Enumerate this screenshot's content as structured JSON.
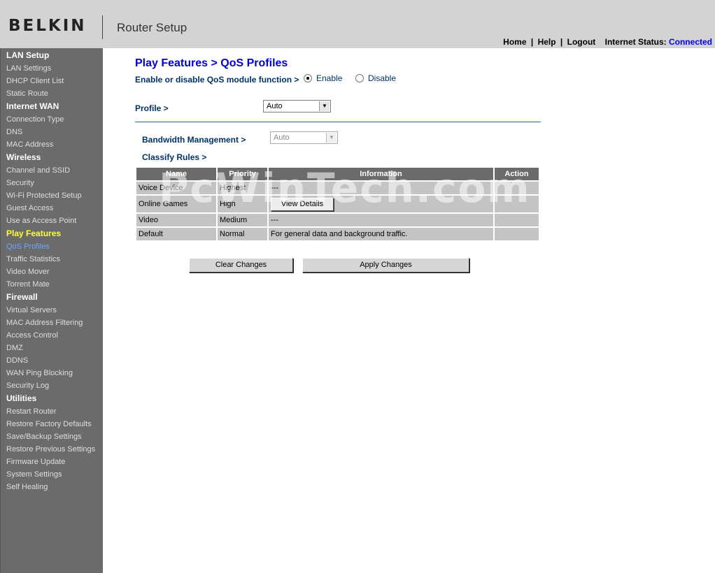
{
  "header": {
    "logo": "BELKIN",
    "title": "Router Setup",
    "nav": {
      "home": "Home",
      "help": "Help",
      "logout": "Logout",
      "separator": "|",
      "status_label": "Internet Status:",
      "status_value": "Connected"
    }
  },
  "sidebar": {
    "sections": [
      {
        "title": "LAN Setup",
        "items": [
          "LAN Settings",
          "DHCP Client List",
          "Static Route"
        ]
      },
      {
        "title": "Internet WAN",
        "items": [
          "Connection Type",
          "DNS",
          "MAC Address"
        ]
      },
      {
        "title": "Wireless",
        "items": [
          "Channel and SSID",
          "Security",
          "Wi-Fi Protected Setup",
          "Guest Access",
          "Use as Access Point"
        ]
      },
      {
        "title": "Play Features",
        "items": [
          "QoS Profiles",
          "Traffic Statistics",
          "Video Mover",
          "Torrent Mate"
        ]
      },
      {
        "title": "Firewall",
        "items": [
          "Virtual Servers",
          "MAC Address Filtering",
          "Access Control",
          "DMZ",
          "DDNS",
          "WAN Ping Blocking",
          "Security Log"
        ]
      },
      {
        "title": "Utilities",
        "items": [
          "Restart Router",
          "Restore Factory Defaults",
          "Save/Backup Settings",
          "Restore Previous Settings",
          "Firmware Update",
          "System Settings",
          "Self Healing"
        ]
      }
    ]
  },
  "main": {
    "title": "Play Features > QoS Profiles",
    "qos_label": "Enable or disable QoS module function >",
    "enable_label": "Enable",
    "disable_label": "Disable",
    "qos_state": "Enable",
    "profile_label": "Profile >",
    "profile_value": "Auto",
    "bandwidth_label": "Bandwidth Management >",
    "bandwidth_value": "Auto",
    "classify_label": "Classify Rules >",
    "table": {
      "headers": [
        "Name",
        "Priority",
        "Information",
        "Action"
      ],
      "rows": [
        {
          "name": "Voice Device",
          "priority": "Highest",
          "info": "---",
          "action": ""
        },
        {
          "name": "Online Games",
          "priority": "High",
          "info": "View Details",
          "action": ""
        },
        {
          "name": "Video",
          "priority": "Medium",
          "info": "---",
          "action": ""
        },
        {
          "name": "Default",
          "priority": "Normal",
          "info": "For general data and background traffic.",
          "action": ""
        }
      ]
    },
    "clear_button": "Clear Changes",
    "apply_button": "Apply Changes"
  },
  "watermark": "PcWinTech.com"
}
